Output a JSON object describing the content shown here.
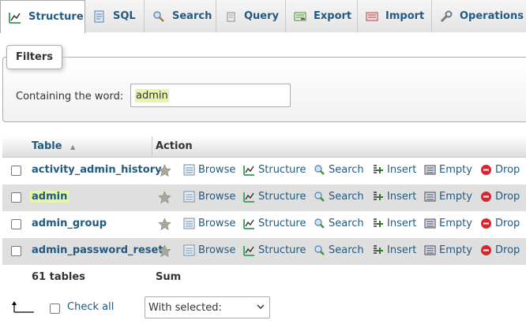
{
  "tabs": [
    {
      "label": "Structure",
      "icon": "structure-icon",
      "active": true
    },
    {
      "label": "SQL",
      "icon": "sql-icon"
    },
    {
      "label": "Search",
      "icon": "search-icon"
    },
    {
      "label": "Query",
      "icon": "query-icon"
    },
    {
      "label": "Export",
      "icon": "export-icon"
    },
    {
      "label": "Import",
      "icon": "import-icon"
    },
    {
      "label": "Operations",
      "icon": "wrench-icon"
    }
  ],
  "filters": {
    "legend": "Filters",
    "label": "Containing the word:",
    "value": "admin"
  },
  "table": {
    "col_table": "Table",
    "col_action": "Action",
    "sort_indicator": "▲",
    "actions": [
      "Browse",
      "Structure",
      "Search",
      "Insert",
      "Empty",
      "Drop"
    ],
    "rows": [
      {
        "name": "activity_admin_history"
      },
      {
        "name": "admin",
        "highlight": true
      },
      {
        "name": "admin_group"
      },
      {
        "name": "admin_password_reset"
      }
    ],
    "footer_count": "61 tables",
    "footer_sum": "Sum"
  },
  "bottom": {
    "check_all": "Check all",
    "with_selected": "With selected:"
  },
  "colors": {
    "link": "#235a81",
    "highlight": "#e6f5a8",
    "drop": "#d9262e"
  }
}
